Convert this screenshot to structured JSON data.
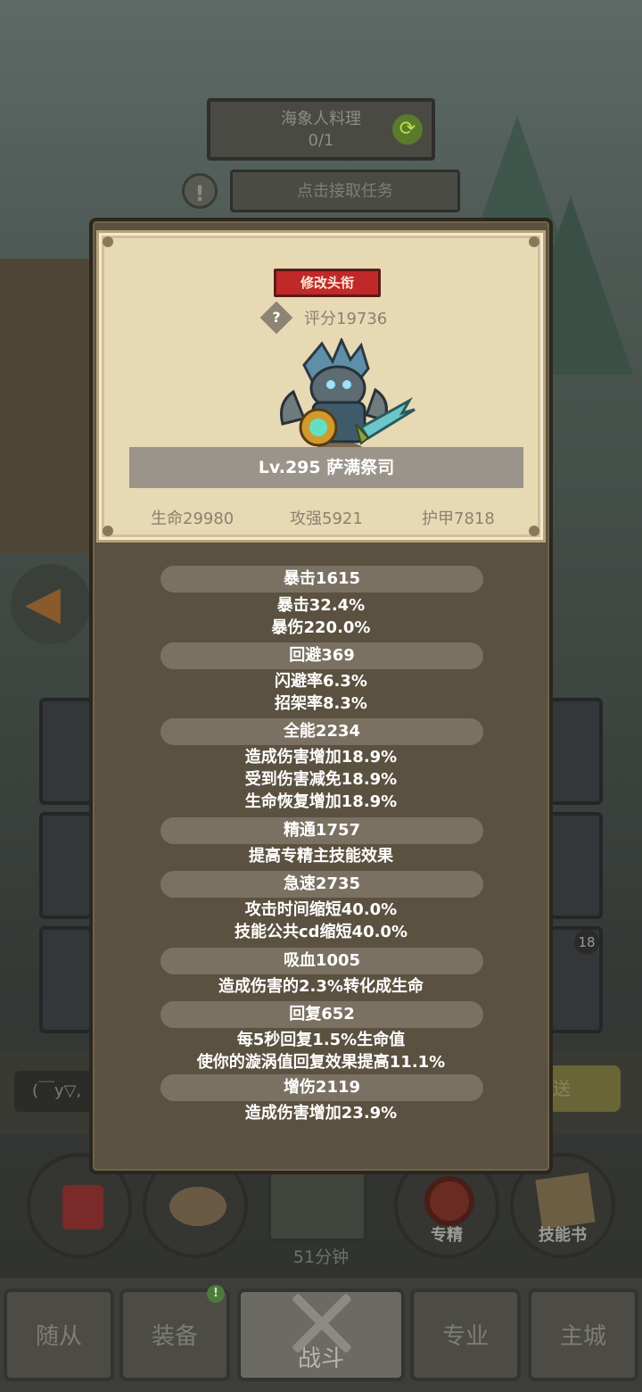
{
  "background": {
    "quest_title": "海象人料理",
    "quest_progress": "0/1",
    "accept_task": "点击接取任务",
    "chat_input_text": "(￣y▽,",
    "send_label": "送",
    "slot_badge": "18",
    "buttons": {
      "specialization": "专精",
      "skill_book": "技能书"
    },
    "chest_timer": "51分钟",
    "tabs": [
      "随从",
      "装备",
      "战斗",
      "专业",
      "主城"
    ],
    "active_tab": "战斗"
  },
  "panel": {
    "title_button": "修改头衔",
    "score": "评分19736",
    "level_name": "Lv.295 萨满祭司",
    "hp": "生命29980",
    "attack": "攻强5921",
    "armor": "护甲7818",
    "attributes": [
      {
        "header": "暴击1615",
        "lines": [
          "暴击32.4%",
          "暴伤220.0%"
        ]
      },
      {
        "header": "回避369",
        "lines": [
          "闪避率6.3%",
          "招架率8.3%"
        ]
      },
      {
        "header": "全能2234",
        "lines": [
          "造成伤害增加18.9%",
          "受到伤害减免18.9%",
          "生命恢复增加18.9%"
        ]
      },
      {
        "header": "精通1757",
        "lines": [
          "提高专精主技能效果"
        ]
      },
      {
        "header": "急速2735",
        "lines": [
          "攻击时间缩短40.0%",
          "技能公共cd缩短40.0%"
        ]
      },
      {
        "header": "吸血1005",
        "lines": [
          "造成伤害的2.3%转化成生命"
        ]
      },
      {
        "header": "回复652",
        "lines": [
          "每5秒回复1.5%生命值",
          "使你的漩涡值回复效果提高11.1%"
        ]
      },
      {
        "header": "增伤2119",
        "lines": [
          "造成伤害增加23.9%"
        ]
      }
    ]
  },
  "colors": {
    "panel_bg": "#5b5140",
    "parchment": "#e8d9b5",
    "title_red": "#c0282a",
    "section_pill": "#7a7163"
  }
}
